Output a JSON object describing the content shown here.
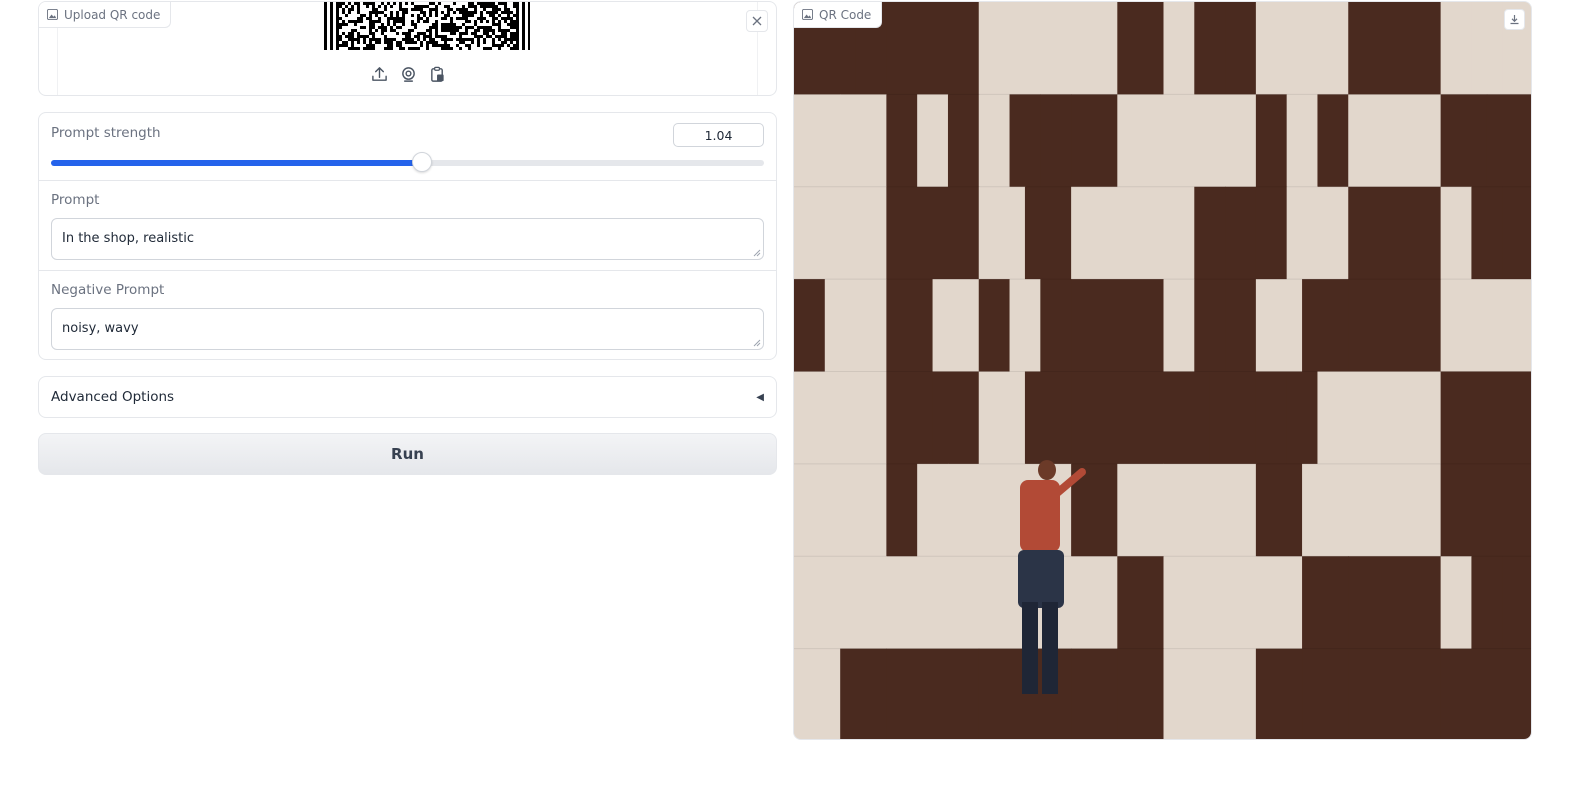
{
  "upload": {
    "label": "Upload QR code",
    "icons": [
      "image-icon",
      "upload-icon",
      "webcam-icon",
      "clipboard-icon",
      "close-icon"
    ]
  },
  "prompt_strength": {
    "label": "Prompt strength",
    "value": "1.04",
    "slider_fraction": 0.52
  },
  "prompt": {
    "label": "Prompt",
    "value": "In the shop, realistic"
  },
  "negative_prompt": {
    "label": "Negative Prompt",
    "value": "noisy, wavy"
  },
  "advanced": {
    "label": "Advanced Options",
    "caret": "◀"
  },
  "run_button": {
    "label": "Run"
  },
  "output": {
    "label": "QR Code",
    "icons": [
      "image-icon",
      "download-icon"
    ]
  },
  "colors": {
    "accent": "#2563eb",
    "tile_dark": "#4a2a1f",
    "tile_light": "#e2d7cc"
  }
}
